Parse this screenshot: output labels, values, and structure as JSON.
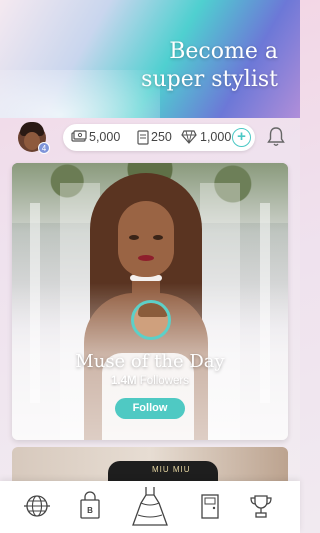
{
  "banner": {
    "title": "Become a super stylist"
  },
  "player": {
    "level": "4"
  },
  "currency": {
    "cash": "5,000",
    "tickets": "250",
    "diamonds": "1,000",
    "add_label": "+"
  },
  "card": {
    "title": "Muse of the Day",
    "followers_count": "1.4M",
    "followers_label": "Followers",
    "follow_label": "Follow"
  },
  "next_card": {
    "glasses_text": "MIU MIU"
  },
  "nav": {
    "items": [
      {
        "icon": "globe-icon"
      },
      {
        "icon": "shopping-bag-icon",
        "badge": "B"
      },
      {
        "icon": "dress-icon",
        "active": true
      },
      {
        "icon": "door-icon"
      },
      {
        "icon": "trophy-icon"
      }
    ]
  },
  "colors": {
    "accent_teal": "#4fc9c3",
    "level_badge": "#7f94d9"
  }
}
